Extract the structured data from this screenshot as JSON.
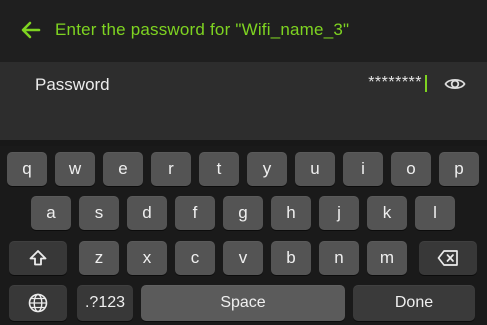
{
  "header": {
    "title": "Enter the password for \"Wifi_name_3\""
  },
  "field": {
    "label": "Password",
    "value": "********"
  },
  "keyboard": {
    "row1": [
      "q",
      "w",
      "e",
      "r",
      "t",
      "y",
      "u",
      "i",
      "o",
      "p"
    ],
    "row2": [
      "a",
      "s",
      "d",
      "f",
      "g",
      "h",
      "j",
      "k",
      "l"
    ],
    "row3": [
      "z",
      "x",
      "c",
      "v",
      "b",
      "n",
      "m"
    ],
    "symbols_label": ".?123",
    "space_label": "Space",
    "done_label": "Done"
  },
  "colors": {
    "accent": "#7ed321",
    "key": "#545454",
    "key_dark": "#383838"
  },
  "icons": {
    "back": "arrow-left-icon",
    "visibility": "eye-icon",
    "shift": "shift-icon",
    "backspace": "backspace-icon",
    "language": "globe-icon"
  }
}
